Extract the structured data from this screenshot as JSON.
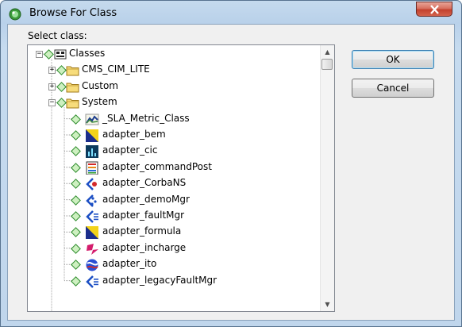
{
  "window": {
    "title": "Browse For Class",
    "app_icon": "green-circle-icon"
  },
  "dialog": {
    "label": "Select class:",
    "buttons": {
      "ok": "OK",
      "cancel": "Cancel"
    }
  },
  "tree": {
    "nodes": [
      {
        "label": "Classes",
        "icon": "classes-icon",
        "expander": "minus",
        "level": 0
      },
      {
        "label": "CMS_CIM_LITE",
        "icon": "folder-icon",
        "expander": "plus",
        "level": 1
      },
      {
        "label": "Custom",
        "icon": "folder-icon",
        "expander": "plus",
        "level": 1
      },
      {
        "label": "System",
        "icon": "folder-icon",
        "expander": "minus",
        "level": 1
      },
      {
        "label": "_SLA_Metric_Class",
        "icon": "sla-metric-icon",
        "level": 2
      },
      {
        "label": "adapter_bem",
        "icon": "bem-icon",
        "level": 2
      },
      {
        "label": "adapter_cic",
        "icon": "cic-icon",
        "level": 2
      },
      {
        "label": "adapter_commandPost",
        "icon": "command-post-icon",
        "level": 2
      },
      {
        "label": "adapter_CorbaNS",
        "icon": "corba-icon",
        "level": 2
      },
      {
        "label": "adapter_demoMgr",
        "icon": "demo-mgr-icon",
        "level": 2
      },
      {
        "label": "adapter_faultMgr",
        "icon": "fault-mgr-icon",
        "level": 2
      },
      {
        "label": "adapter_formula",
        "icon": "formula-icon",
        "level": 2
      },
      {
        "label": "adapter_incharge",
        "icon": "incharge-icon",
        "level": 2
      },
      {
        "label": "adapter_ito",
        "icon": "ito-icon",
        "level": 2
      },
      {
        "label": "adapter_legacyFaultMgr",
        "icon": "legacy-fault-mgr-icon",
        "level": 2
      }
    ]
  }
}
